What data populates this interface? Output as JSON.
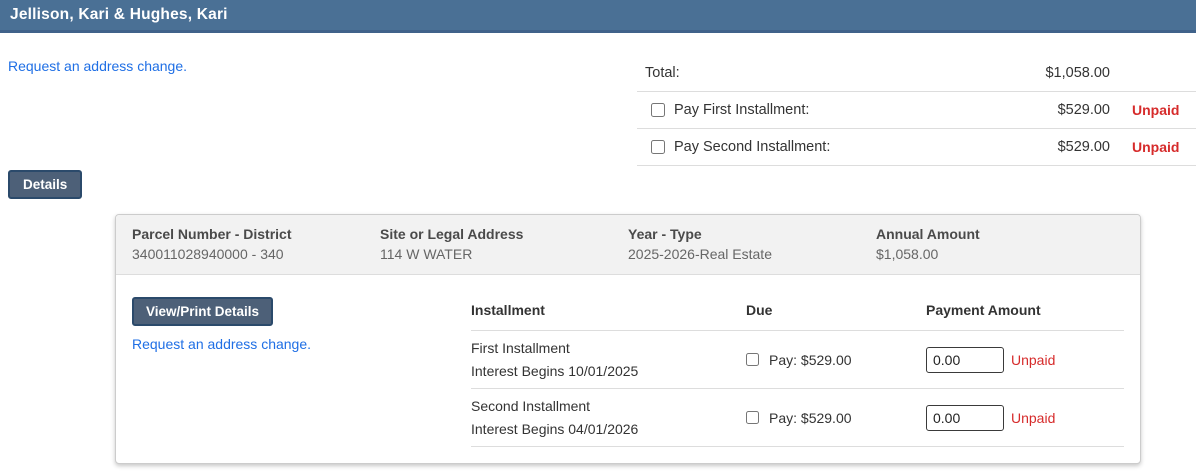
{
  "header": {
    "title": "Jellison, Kari & Hughes, Kari"
  },
  "top": {
    "address_change_link": "Request an address change."
  },
  "summary": {
    "rows": [
      {
        "label": "Total:",
        "amount": "$1,058.00",
        "has_checkbox": false,
        "status": ""
      },
      {
        "label": "Pay First Installment:",
        "amount": "$529.00",
        "has_checkbox": true,
        "status": "Unpaid"
      },
      {
        "label": "Pay Second Installment:",
        "amount": "$529.00",
        "has_checkbox": true,
        "status": "Unpaid"
      }
    ]
  },
  "details_tab": {
    "label": "Details"
  },
  "panel": {
    "header_columns": [
      {
        "label": "Parcel Number - District",
        "value": "340011028940000 - 340"
      },
      {
        "label": "Site or Legal Address",
        "value": "114 W WATER"
      },
      {
        "label": "Year - Type",
        "value": "2025-2026-Real Estate"
      },
      {
        "label": "Annual Amount",
        "value": "$1,058.00"
      }
    ],
    "view_print_label": "View/Print Details",
    "address_change_link": "Request an address change.",
    "table": {
      "headers": [
        "Installment",
        "Due",
        "Payment Amount"
      ],
      "rows": [
        {
          "name": "First Installment",
          "note": "Interest Begins 10/01/2025",
          "due": "Pay: $529.00",
          "amount_value": "0.00",
          "status": "Unpaid"
        },
        {
          "name": "Second Installment",
          "note": "Interest Begins 04/01/2026",
          "due": "Pay: $529.00",
          "amount_value": "0.00",
          "status": "Unpaid"
        }
      ]
    }
  },
  "colors": {
    "header_bg": "#4a7095",
    "button_bg": "#4d6078",
    "button_border": "#2b4a6b",
    "link": "#1f6fe5",
    "unpaid_red": "#d62b2b",
    "panel_header_bg": "#f2f2f2"
  }
}
